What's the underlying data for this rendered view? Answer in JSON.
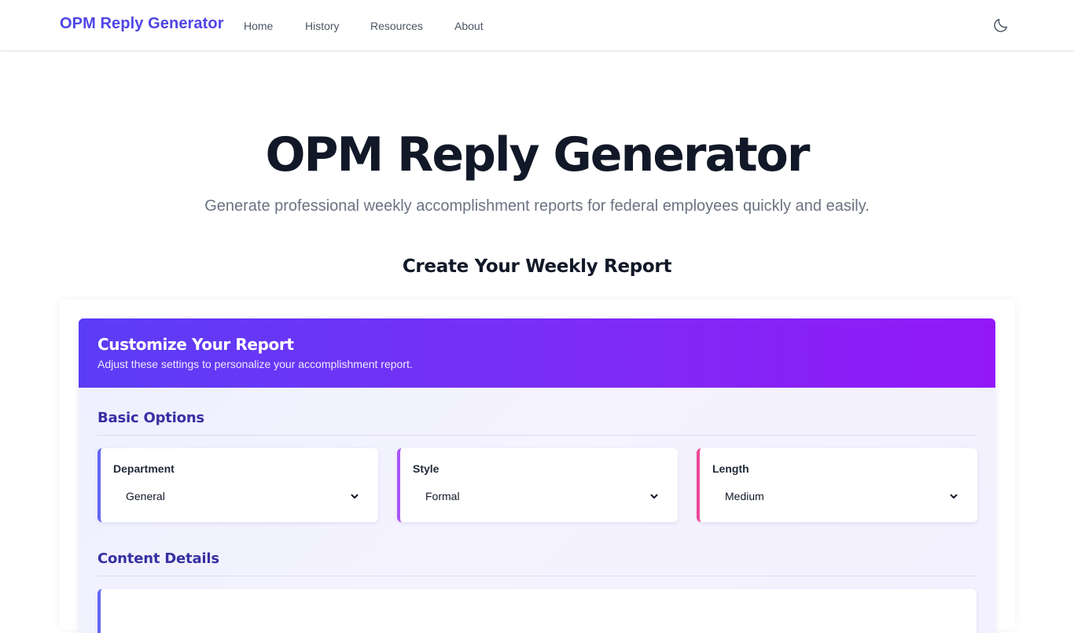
{
  "nav": {
    "brand": "OPM Reply Generator",
    "links": [
      "Home",
      "History",
      "Resources",
      "About"
    ],
    "theme_icon": "moon-icon"
  },
  "hero": {
    "title": "OPM Reply Generator",
    "subtitle": "Generate professional weekly accomplishment reports for federal employees quickly and easily."
  },
  "section": {
    "title": "Create Your Weekly Report"
  },
  "panel": {
    "title": "Customize Your Report",
    "description": "Adjust these settings to personalize your accomplishment report.",
    "basic_options_title": "Basic Options",
    "content_details_title": "Content Details",
    "options": [
      {
        "label": "Department",
        "value": "General"
      },
      {
        "label": "Style",
        "value": "Formal"
      },
      {
        "label": "Length",
        "value": "Medium"
      }
    ]
  },
  "colors": {
    "brand": "#4f46e5",
    "header_gradient_start": "#5b3df5",
    "header_gradient_end": "#9318f8",
    "department_accent": "#6366f1",
    "style_accent": "#a855f7",
    "length_accent": "#ec4899"
  }
}
